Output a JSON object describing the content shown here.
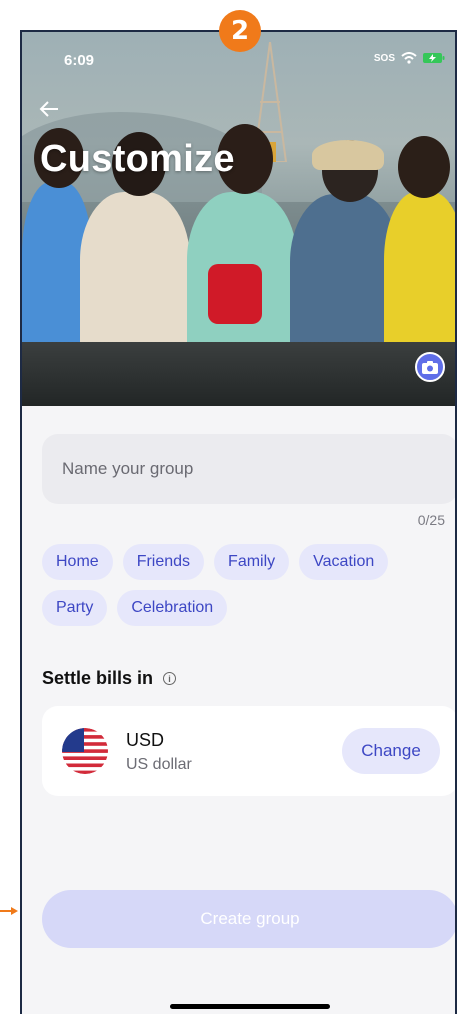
{
  "annotation": {
    "step_number": "2"
  },
  "status_bar": {
    "time": "6:09",
    "sos": "SOS"
  },
  "header": {
    "title": "Customize"
  },
  "form": {
    "name_placeholder": "Name your group",
    "name_value": "",
    "char_counter": "0/25"
  },
  "tags": [
    "Home",
    "Friends",
    "Family",
    "Vacation",
    "Party",
    "Celebration"
  ],
  "settle": {
    "label": "Settle bills in",
    "currency_code": "USD",
    "currency_name": "US dollar",
    "change_label": "Change"
  },
  "actions": {
    "create_label": "Create group"
  },
  "colors": {
    "accent": "#3d47c4",
    "accent_soft": "#e6e7fb",
    "create_disabled": "#d6d8f8",
    "annotation": "#f07a1a"
  },
  "icons": {
    "back": "arrow-left-icon",
    "camera": "camera-icon",
    "info": "info-icon",
    "flag": "us-flag-icon"
  }
}
